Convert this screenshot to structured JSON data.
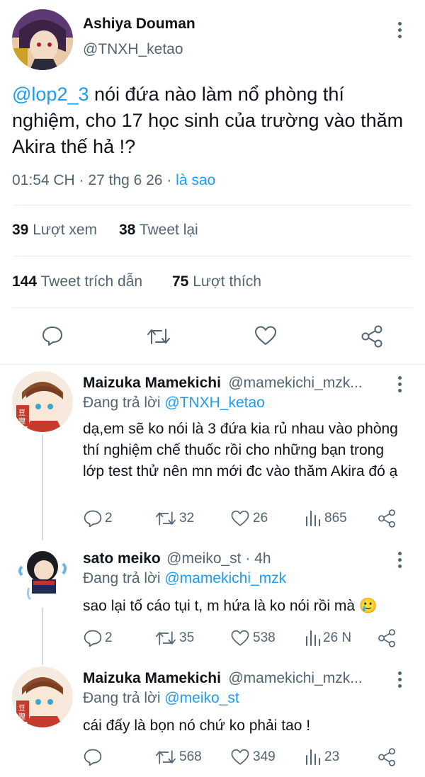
{
  "main": {
    "author_name": "Ashiya Douman",
    "author_handle": "@TNXH_ketao",
    "mention": "@lop2_3",
    "text": " nói đứa nào làm nổ phòng thí nghiệm, cho 17 học sinh của trường vào thăm Akira thế hả !?",
    "time": "01:54 CH",
    "date": "27 thg 6 26",
    "source": "là sao",
    "views_count": "39",
    "views_label": "Lượt xem",
    "retweets_count": "38",
    "retweets_label": "Tweet lại",
    "quotes_count": "144",
    "quotes_label": "Tweet trích dẫn",
    "likes_count": "75",
    "likes_label": "Lượt thích"
  },
  "replies": [
    {
      "name": "Maizuka Mamekichi",
      "handle": "@mamekichi_mzk...",
      "replying_label": "Đang trả lời",
      "replying_to": "@TNXH_ketao",
      "text": "dạ,em sẽ ko nói là 3 đứa kia rủ nhau vào phòng thí nghiệm chế thuốc rồi cho những bạn trong lớp test thử nên mn mới đc vào thăm Akira đó ạ",
      "replies": "2",
      "retweets": "32",
      "likes": "26",
      "views": "865"
    },
    {
      "name": "sato meiko",
      "handle": "@meiko_st · 4h",
      "replying_label": "Đang trả lời",
      "replying_to": "@mamekichi_mzk",
      "text": "sao lại tố cáo tụi t, m hứa là ko nói rồi mà 🥲",
      "replies": "2",
      "retweets": "35",
      "likes": "538",
      "views": "26 N"
    },
    {
      "name": "Maizuka Mamekichi",
      "handle": "@mamekichi_mzk...",
      "replying_label": "Đang trả lời",
      "replying_to": "@meiko_st",
      "text": "cái đấy là bọn nó chứ ko phải tao !",
      "replies": "",
      "retweets": "568",
      "likes": "349",
      "views": "23"
    }
  ],
  "colors": {
    "accent": "#1d9bf0",
    "secondary_text": "#536471",
    "divider": "#e6ecf0"
  }
}
